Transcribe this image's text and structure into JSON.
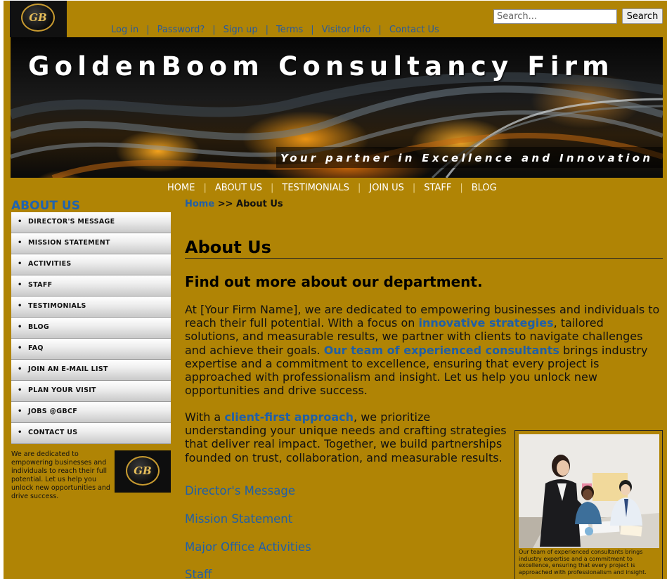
{
  "logo": {
    "text": "GB"
  },
  "top_links": [
    "Log in",
    "Password?",
    "Sign up",
    "Terms",
    "Visitor Info",
    "Contact Us"
  ],
  "search": {
    "placeholder": "Search...",
    "button_label": "Search"
  },
  "banner": {
    "title": "GoldenBoom Consultancy Firm",
    "tagline": "Your partner in Excellence and Innovation"
  },
  "main_nav": [
    "HOME",
    "ABOUT US",
    "TESTIMONIALS",
    "JOIN US",
    "STAFF",
    "BLOG"
  ],
  "sidebar": {
    "title": "ABOUT US",
    "bullet": "•",
    "items": [
      "DIRECTOR'S MESSAGE",
      "MISSION STATEMENT",
      "ACTIVITIES",
      "STAFF",
      "TESTIMONIALS",
      "BLOG",
      "FAQ",
      "JOIN AN E-MAIL LIST",
      "PLAN YOUR VISIT",
      "JOBS @GBCF",
      "CONTACT US"
    ],
    "blurb": "We are dedicated to empowering businesses and individuals to reach their full potential. Let us help you unlock new opportunities and drive success."
  },
  "breadcrumb": {
    "home": "Home",
    "separator": ">>",
    "current": "About Us"
  },
  "content": {
    "title": "About Us",
    "subtitle": "Find out more about our department.",
    "para1": {
      "p1": "At [Your Firm Name], we are dedicated to empowering businesses and individuals to reach their full potential. With a focus on ",
      "h1": "innovative strategies",
      "p2": ", tailored solutions, and measurable results, we partner with clients to navigate challenges and achieve their goals. ",
      "h2": "Our team of experienced consultants",
      "p3": " brings industry expertise and a commitment to excellence, ensuring that every project is approached with professionalism and insight. Let us help you unlock new opportunities and drive success."
    },
    "para2": {
      "p1": "With a ",
      "h1": "client-first approach",
      "p2": ", we prioritize understanding your unique needs and crafting strategies that deliver real impact. Together, we build partnerships founded on trust, collaboration, and measurable results."
    },
    "links": [
      "Director's Message",
      "Mission Statement",
      "Major Office Activities",
      "Staff"
    ]
  },
  "photo": {
    "caption": "Our team of experienced consultants brings industry expertise and a commitment to excellence, ensuring that every project is approached with professionalism and insight."
  },
  "colors": {
    "page_gold": "#b08405",
    "link_blue": "#1f5fa8",
    "sidebar_title_blue": "#1f63b0"
  }
}
